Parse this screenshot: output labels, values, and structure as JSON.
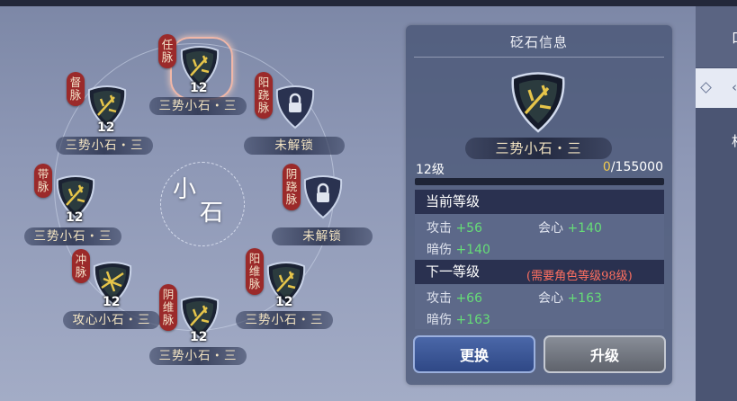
{
  "center_label": [
    "小",
    "石"
  ],
  "nodes": [
    {
      "meridian": "任\n脉",
      "level": "12",
      "name": "三势小石・三",
      "locked": false,
      "selected": true
    },
    {
      "meridian": "阳\n跷\n脉",
      "level": "",
      "name": "未解锁",
      "locked": true
    },
    {
      "meridian": "阴\n跷\n脉",
      "level": "",
      "name": "未解锁",
      "locked": true
    },
    {
      "meridian": "阳\n维\n脉",
      "level": "12",
      "name": "三势小石・三",
      "locked": false
    },
    {
      "meridian": "阴\n维\n脉",
      "level": "12",
      "name": "三势小石・三",
      "locked": false
    },
    {
      "meridian": "冲\n脉",
      "level": "12",
      "name": "攻心小石・三",
      "locked": false
    },
    {
      "meridian": "带\n脉",
      "level": "12",
      "name": "三势小石・三",
      "locked": false
    },
    {
      "meridian": "督\n脉",
      "level": "12",
      "name": "三势小石・三",
      "locked": false
    }
  ],
  "panel": {
    "title": "砭石信息",
    "stone_name": "三势小石・三",
    "level_text": "12级",
    "progress_current": "0",
    "progress_total": "/155000",
    "progress_fraction": 0,
    "current_header": "当前等级",
    "next_header": "下一等级",
    "next_requirement": "(需要角色等级98级)",
    "current_stats": [
      {
        "label": "攻击",
        "value": "+56"
      },
      {
        "label": "会心",
        "value": "+140"
      },
      {
        "label": "暗伤",
        "value": "+140"
      }
    ],
    "next_stats": [
      {
        "label": "攻击",
        "value": "+66"
      },
      {
        "label": "会心",
        "value": "+163"
      },
      {
        "label": "暗伤",
        "value": "+163"
      }
    ],
    "btn_change": "更换",
    "btn_upgrade": "升级"
  },
  "side_tabs": [
    "口",
    "‹",
    "相"
  ],
  "colors": {
    "stat_green": "#66dd77",
    "gold": "#f0c94e",
    "requirement_red": "#ff7060",
    "label_red": "#9b2a2a"
  }
}
